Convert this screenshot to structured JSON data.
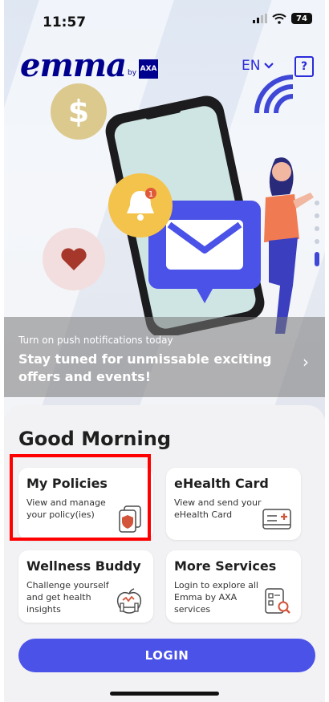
{
  "status": {
    "time": "11:57",
    "battery": "74"
  },
  "header": {
    "logo": {
      "word": "emma",
      "by": "by",
      "brand": "AXA"
    },
    "language": "EN"
  },
  "promo": {
    "subtitle": "Turn on push notifications today",
    "title": "Stay tuned for unmissable exciting offers and events!"
  },
  "home": {
    "greeting": "Good Morning",
    "cards": [
      {
        "title": "My Policies",
        "desc": "View and manage your policy(ies)"
      },
      {
        "title": "eHealth Card",
        "desc": "View and send your eHealth Card"
      },
      {
        "title": "Wellness Buddy",
        "desc": "Challenge yourself and get health insights"
      },
      {
        "title": "More Services",
        "desc": "Login to explore all Emma by AXA services"
      }
    ],
    "login_label": "LOGIN"
  },
  "colors": {
    "primary": "#4a52e8",
    "brand": "#00008f",
    "highlight": "#ff0000",
    "coin": "#dcc98e",
    "bell": "#f4c34c"
  },
  "icons": [
    "signal-icon",
    "wifi-icon",
    "battery-icon",
    "chevron-down-icon",
    "help-icon",
    "dollar-icon",
    "heart-icon",
    "bell-icon",
    "envelope-icon",
    "policy-shield-icon",
    "ehealth-card-icon",
    "dumbbell-apple-icon",
    "document-search-icon"
  ]
}
